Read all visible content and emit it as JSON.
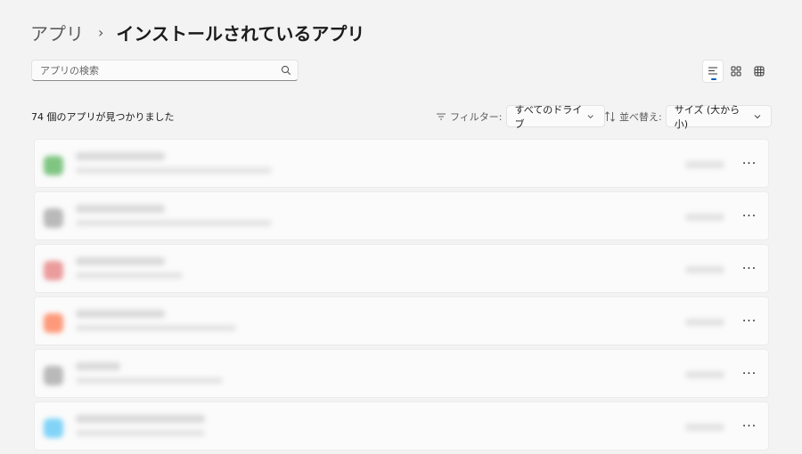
{
  "breadcrumb": {
    "parent": "アプリ",
    "separator": "›",
    "current": "インストールされているアプリ"
  },
  "search": {
    "placeholder": "アプリの検索",
    "icon": "search-icon"
  },
  "view_toggle": [
    {
      "name": "list-view",
      "icon": "list-view-icon",
      "active": true
    },
    {
      "name": "tile-view",
      "icon": "tile-view-icon",
      "active": false
    },
    {
      "name": "grid-view",
      "icon": "grid-view-icon",
      "active": false
    }
  ],
  "summary": {
    "count_text": "74 個のアプリが見つかりました"
  },
  "filter": {
    "label": "フィルター:",
    "value": "すべてのドライブ",
    "icon": "filter-icon"
  },
  "sort": {
    "label": "並べ替え:",
    "value": "サイズ (大から小)",
    "icon": "sort-icon"
  },
  "apps": [
    {
      "more_label": "···",
      "icon_color": "#4caf50"
    },
    {
      "more_label": "···",
      "icon_color": "#9e9e9e"
    },
    {
      "more_label": "···",
      "icon_color": "#e57373"
    },
    {
      "more_label": "···",
      "icon_color": "#ff7043"
    },
    {
      "more_label": "···",
      "icon_color": "#9e9e9e"
    },
    {
      "more_label": "···",
      "icon_color": "#4fc3f7"
    }
  ]
}
